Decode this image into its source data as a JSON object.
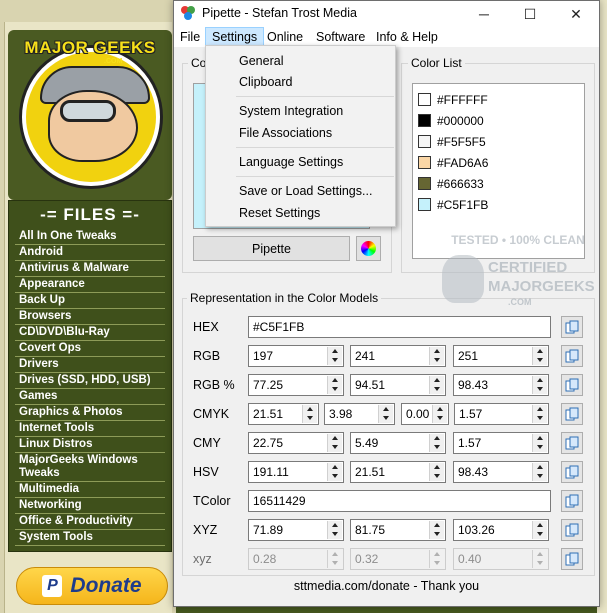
{
  "background": {
    "logo_text": "MAJOR GEEKS",
    "logo_sub": ".COM",
    "files_title": "-= FILES =-",
    "categories": [
      "All In One Tweaks",
      "Android",
      "Antivirus & Malware",
      "Appearance",
      "Back Up",
      "Browsers",
      "CD\\DVD\\Blu-Ray",
      "Covert Ops",
      "Drivers",
      "Drives (SSD, HDD, USB)",
      "Games",
      "Graphics & Photos",
      "Internet Tools",
      "Linux Distros",
      "MajorGeeks Windows Tweaks",
      "Multimedia",
      "Networking",
      "Office & Productivity",
      "System Tools"
    ],
    "donate_label": "Donate",
    "watermark": {
      "line1": "TESTED • 100% CLEAN",
      "line2": "CERTIFIED",
      "line3": "MAJORGEEKS",
      "line4": ".COM"
    }
  },
  "window": {
    "title": "Pipette - Stefan Trost Media",
    "controls": {
      "minimize": "─",
      "maximize": "☐",
      "close": "✕"
    }
  },
  "menubar": {
    "items": [
      "File",
      "Settings",
      "Online",
      "Software",
      "Info & Help"
    ],
    "active": "Settings"
  },
  "settings_menu": {
    "groups": [
      [
        "General",
        "Clipboard"
      ],
      [
        "System Integration",
        "File Associations"
      ],
      [
        "Language Settings"
      ],
      [
        "Save or Load Settings...",
        "Reset Settings"
      ]
    ]
  },
  "color_panel": {
    "group_label": "Co",
    "preview_color": "#C5F1FB",
    "pipette_button": "Pipette"
  },
  "color_list": {
    "label": "Color List",
    "items": [
      {
        "hex": "#FFFFFF",
        "swatch": "#FFFFFF"
      },
      {
        "hex": "#000000",
        "swatch": "#000000"
      },
      {
        "hex": "#F5F5F5",
        "swatch": "#F5F5F5"
      },
      {
        "hex": "#FAD6A6",
        "swatch": "#FAD6A6"
      },
      {
        "hex": "#666633",
        "swatch": "#666633"
      },
      {
        "hex": "#C5F1FB",
        "swatch": "#C5F1FB"
      }
    ]
  },
  "models": {
    "label": "Representation in the Color Models",
    "rows": [
      {
        "label": "HEX",
        "values": [
          "#C5F1FB"
        ],
        "spin": false,
        "disabled": false
      },
      {
        "label": "RGB",
        "values": [
          "197",
          "241",
          "251"
        ],
        "spin": true,
        "disabled": false
      },
      {
        "label": "RGB %",
        "values": [
          "77.25",
          "94.51",
          "98.43"
        ],
        "spin": true,
        "disabled": false
      },
      {
        "label": "CMYK",
        "values": [
          "21.51",
          "3.98",
          "0.00",
          "1.57"
        ],
        "spin": true,
        "disabled": false
      },
      {
        "label": "CMY",
        "values": [
          "22.75",
          "5.49",
          "1.57"
        ],
        "spin": true,
        "disabled": false
      },
      {
        "label": "HSV",
        "values": [
          "191.11",
          "21.51",
          "98.43"
        ],
        "spin": true,
        "disabled": false
      },
      {
        "label": "TColor",
        "values": [
          "16511429"
        ],
        "spin": false,
        "disabled": false
      },
      {
        "label": "XYZ",
        "values": [
          "71.89",
          "81.75",
          "103.26"
        ],
        "spin": true,
        "disabled": false
      },
      {
        "label": "xyz",
        "values": [
          "0.28",
          "0.32",
          "0.40"
        ],
        "spin": true,
        "disabled": true
      }
    ]
  },
  "footer": "sttmedia.com/donate - Thank you",
  "icons": {
    "app": "pipette-app-icon",
    "copy": "copy-icon",
    "color_wheel": "color-wheel-icon",
    "paypal": "paypal-icon"
  }
}
